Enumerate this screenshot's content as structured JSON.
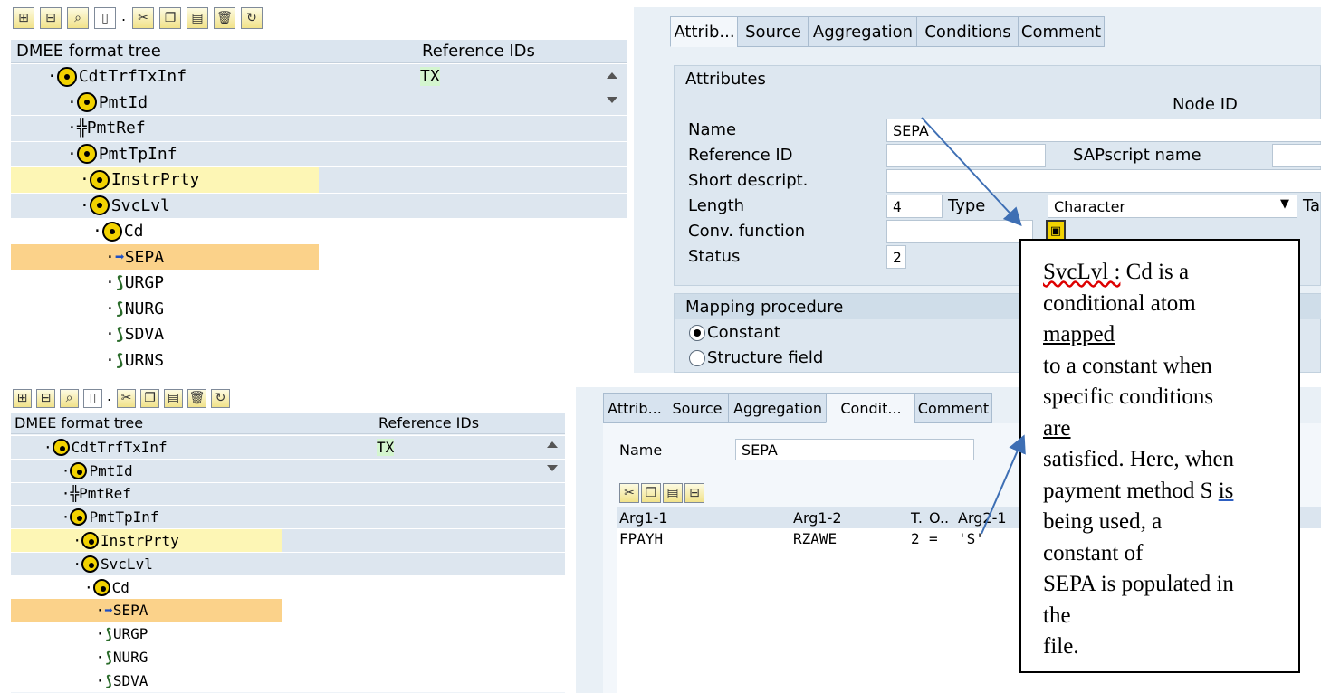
{
  "top": {
    "toolbar_icons": [
      "expand-all-icon",
      "collapse-all-icon",
      "binoculars-icon",
      "new-page-icon",
      "cut-icon",
      "copy-icon",
      "paste-icon",
      "delete-icon",
      "refresh-icon"
    ],
    "tree_header": "DMEE format tree",
    "ref_header": "Reference IDs",
    "tree": [
      {
        "label": "CdtTrfTxInf",
        "icon": "node",
        "ref": "TX"
      },
      {
        "label": "PmtId",
        "icon": "node"
      },
      {
        "label": "PmtRef",
        "icon": "structure"
      },
      {
        "label": "PmtTpInf",
        "icon": "node"
      },
      {
        "label": "InstrPrty",
        "icon": "node"
      },
      {
        "label": "SvcLvl",
        "icon": "node"
      },
      {
        "label": "Cd",
        "icon": "node"
      },
      {
        "label": "SEPA",
        "icon": "arrow"
      },
      {
        "label": "URGP",
        "icon": "atom"
      },
      {
        "label": "NURG",
        "icon": "atom"
      },
      {
        "label": "SDVA",
        "icon": "atom"
      },
      {
        "label": "URNS",
        "icon": "atom"
      }
    ],
    "tabs": [
      "Attrib...",
      "Source",
      "Aggregation",
      "Conditions",
      "Comment"
    ],
    "attributes_title": "Attributes",
    "node_id_label": "Node ID",
    "fields": {
      "name_label": "Name",
      "name_value": "SEPA",
      "refid_label": "Reference ID",
      "sapscript_label": "SAPscript name",
      "short_label": "Short descript.",
      "length_label": "Length",
      "length_value": "4",
      "type_label": "Type",
      "type_value": "Character",
      "type_extra": "Ta",
      "conv_label": "Conv. function",
      "status_label": "Status",
      "status_value": "2"
    },
    "mapping_title": "Mapping procedure",
    "radio_constant": "Constant",
    "radio_structure": "Structure field"
  },
  "bottom": {
    "tree_header": "DMEE format tree",
    "ref_header": "Reference IDs",
    "tree": [
      {
        "label": "CdtTrfTxInf",
        "icon": "node",
        "ref": "TX"
      },
      {
        "label": "PmtId",
        "icon": "node"
      },
      {
        "label": "PmtRef",
        "icon": "structure"
      },
      {
        "label": "PmtTpInf",
        "icon": "node"
      },
      {
        "label": "InstrPrty",
        "icon": "node"
      },
      {
        "label": "SvcLvl",
        "icon": "node"
      },
      {
        "label": "Cd",
        "icon": "node"
      },
      {
        "label": "SEPA",
        "icon": "arrow"
      },
      {
        "label": "URGP",
        "icon": "atom"
      },
      {
        "label": "NURG",
        "icon": "atom"
      },
      {
        "label": "SDVA",
        "icon": "atom"
      }
    ],
    "tabs": [
      "Attrib...",
      "Source",
      "Aggregation",
      "Condit...",
      "Comment"
    ],
    "name_label": "Name",
    "name_value": "SEPA",
    "grid_headers": [
      "Arg1-1",
      "Arg1-2",
      "T.",
      "O..",
      "Arg2-1"
    ],
    "grid_row": [
      "FPAYH",
      "RZAWE",
      "2",
      "=",
      "'S'"
    ]
  },
  "callout": {
    "lines": [
      "SvcLvl : Cd is a",
      "conditional atom",
      "mapped",
      "to a constant when",
      "specific conditions",
      "are",
      "satisfied. Here, when",
      "payment method S is",
      "being used, a",
      "constant of",
      "SEPA is populated in",
      "the",
      "file."
    ]
  },
  "colors": {
    "selected": "#fbd28a",
    "instr_highlight": "#fdf6b5",
    "ref_green": "#d4f5cf",
    "arrow": "#3e6fb4"
  }
}
